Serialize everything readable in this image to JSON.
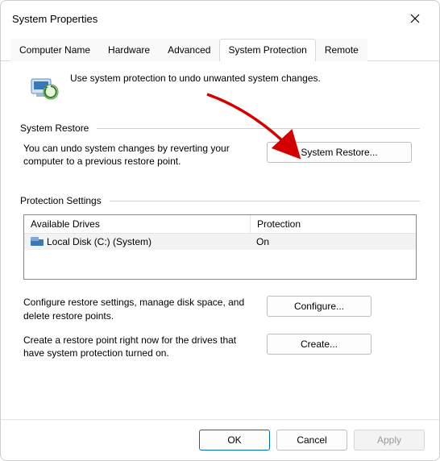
{
  "window": {
    "title": "System Properties"
  },
  "tabs": [
    {
      "label": "Computer Name"
    },
    {
      "label": "Hardware"
    },
    {
      "label": "Advanced"
    },
    {
      "label": "System Protection",
      "active": true
    },
    {
      "label": "Remote"
    }
  ],
  "intro": {
    "text": "Use system protection to undo unwanted system changes."
  },
  "sections": {
    "restore": {
      "title": "System Restore",
      "text": "You can undo system changes by reverting your computer to a previous restore point.",
      "button": "System Restore..."
    },
    "protection": {
      "title": "Protection Settings",
      "columns": {
        "a": "Available Drives",
        "b": "Protection"
      },
      "drives": [
        {
          "name": "Local Disk (C:) (System)",
          "protection": "On"
        }
      ],
      "configure_text": "Configure restore settings, manage disk space, and delete restore points.",
      "configure_button": "Configure...",
      "create_text": "Create a restore point right now for the drives that have system protection turned on.",
      "create_button": "Create..."
    }
  },
  "footer": {
    "ok": "OK",
    "cancel": "Cancel",
    "apply": "Apply"
  },
  "annotation": {
    "arrow_color": "#d40000"
  }
}
